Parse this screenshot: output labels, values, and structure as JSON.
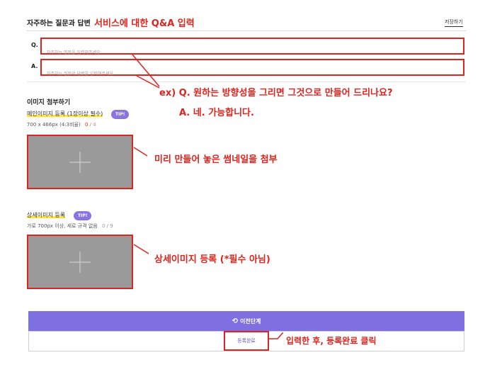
{
  "faq": {
    "title": "자주하는 질문과 답변",
    "title_annotation": "서비스에 대한 Q&A 입력",
    "save_label": "저장하기",
    "q_label": "Q.",
    "q_placeholder": "자주하는 질문을 입력해주세요",
    "a_label": "A.",
    "a_placeholder": "자주하는 질문의 답변을 입력해주세요",
    "example_line1": "ex) Q. 원하는 방향성을 그리면 그것으로 만들어 드리나요?",
    "example_line2": "A.  네. 가능합니다."
  },
  "attach": {
    "title": "이미지 첨부하기",
    "main": {
      "label": "메인이미지 등록 (1장이상 필수)",
      "tip": "TIP!",
      "size_text": "700 x 466px (4:3비율)",
      "count_current": "0",
      "count_sep": " / ",
      "count_max": "4",
      "annotation": "미리 만들어 놓은 썸네일을 첨부"
    },
    "detail": {
      "label": "상세이미지 등록",
      "tip": "TIP!",
      "size_text": "가로 700px 이상, 세로 규격 없음",
      "count": "0 / 9",
      "annotation": "상세이미지 등록 (*필수 아님)"
    }
  },
  "footer": {
    "prev_icon": "undo-icon",
    "prev_label": "이전단계",
    "complete_label": "등록완료",
    "complete_annotation": "입력한 후, 등록완료 클릭"
  },
  "colors": {
    "accent": "#8a74e0",
    "annotation_red": "#e0231c",
    "placeholder_gray": "#9a9a9a"
  }
}
